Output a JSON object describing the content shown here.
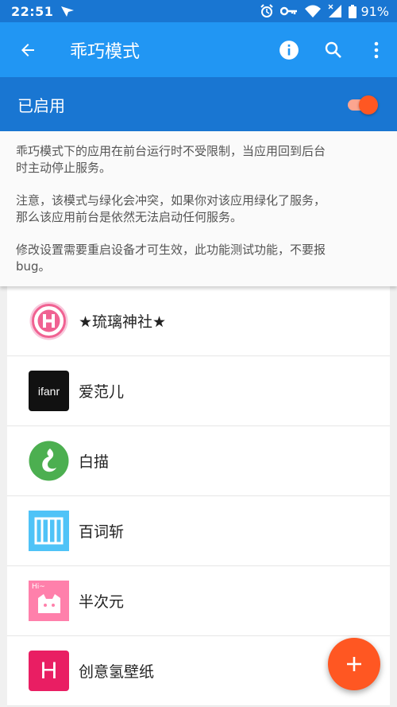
{
  "status_bar": {
    "time": "22:51",
    "battery": "91%"
  },
  "app_bar": {
    "title": "乖巧模式"
  },
  "enabled_bar": {
    "label": "已启用",
    "toggle_on": true
  },
  "description": {
    "p1": "乖巧模式下的应用在前台运行时不受限制，当应用回到后台时主动停止服务。",
    "p2": "注意，该模式与绿化会冲突，如果你对该应用绿化了服务，那么该应用前台是依然无法启动任何服务。",
    "p3": "修改设置需要重启设备才可生效，此功能测试功能，不要报bug。"
  },
  "apps": [
    {
      "name": "★琉璃神社★",
      "icon": "hlili-icon"
    },
    {
      "name": "爱范儿",
      "icon": "ifanr-icon",
      "icon_text": "ifanr"
    },
    {
      "name": "白描",
      "icon": "baimiao-icon"
    },
    {
      "name": "百词斩",
      "icon": "baicizhan-icon"
    },
    {
      "name": "半次元",
      "icon": "bcy-icon",
      "icon_text": "Hi~"
    },
    {
      "name": "创意氢壁纸",
      "icon": "hydrogen-wallpaper-icon",
      "icon_text": "H"
    }
  ],
  "colors": {
    "primary": "#2196f3",
    "primary_dark": "#1976d2",
    "accent": "#ff5722"
  }
}
